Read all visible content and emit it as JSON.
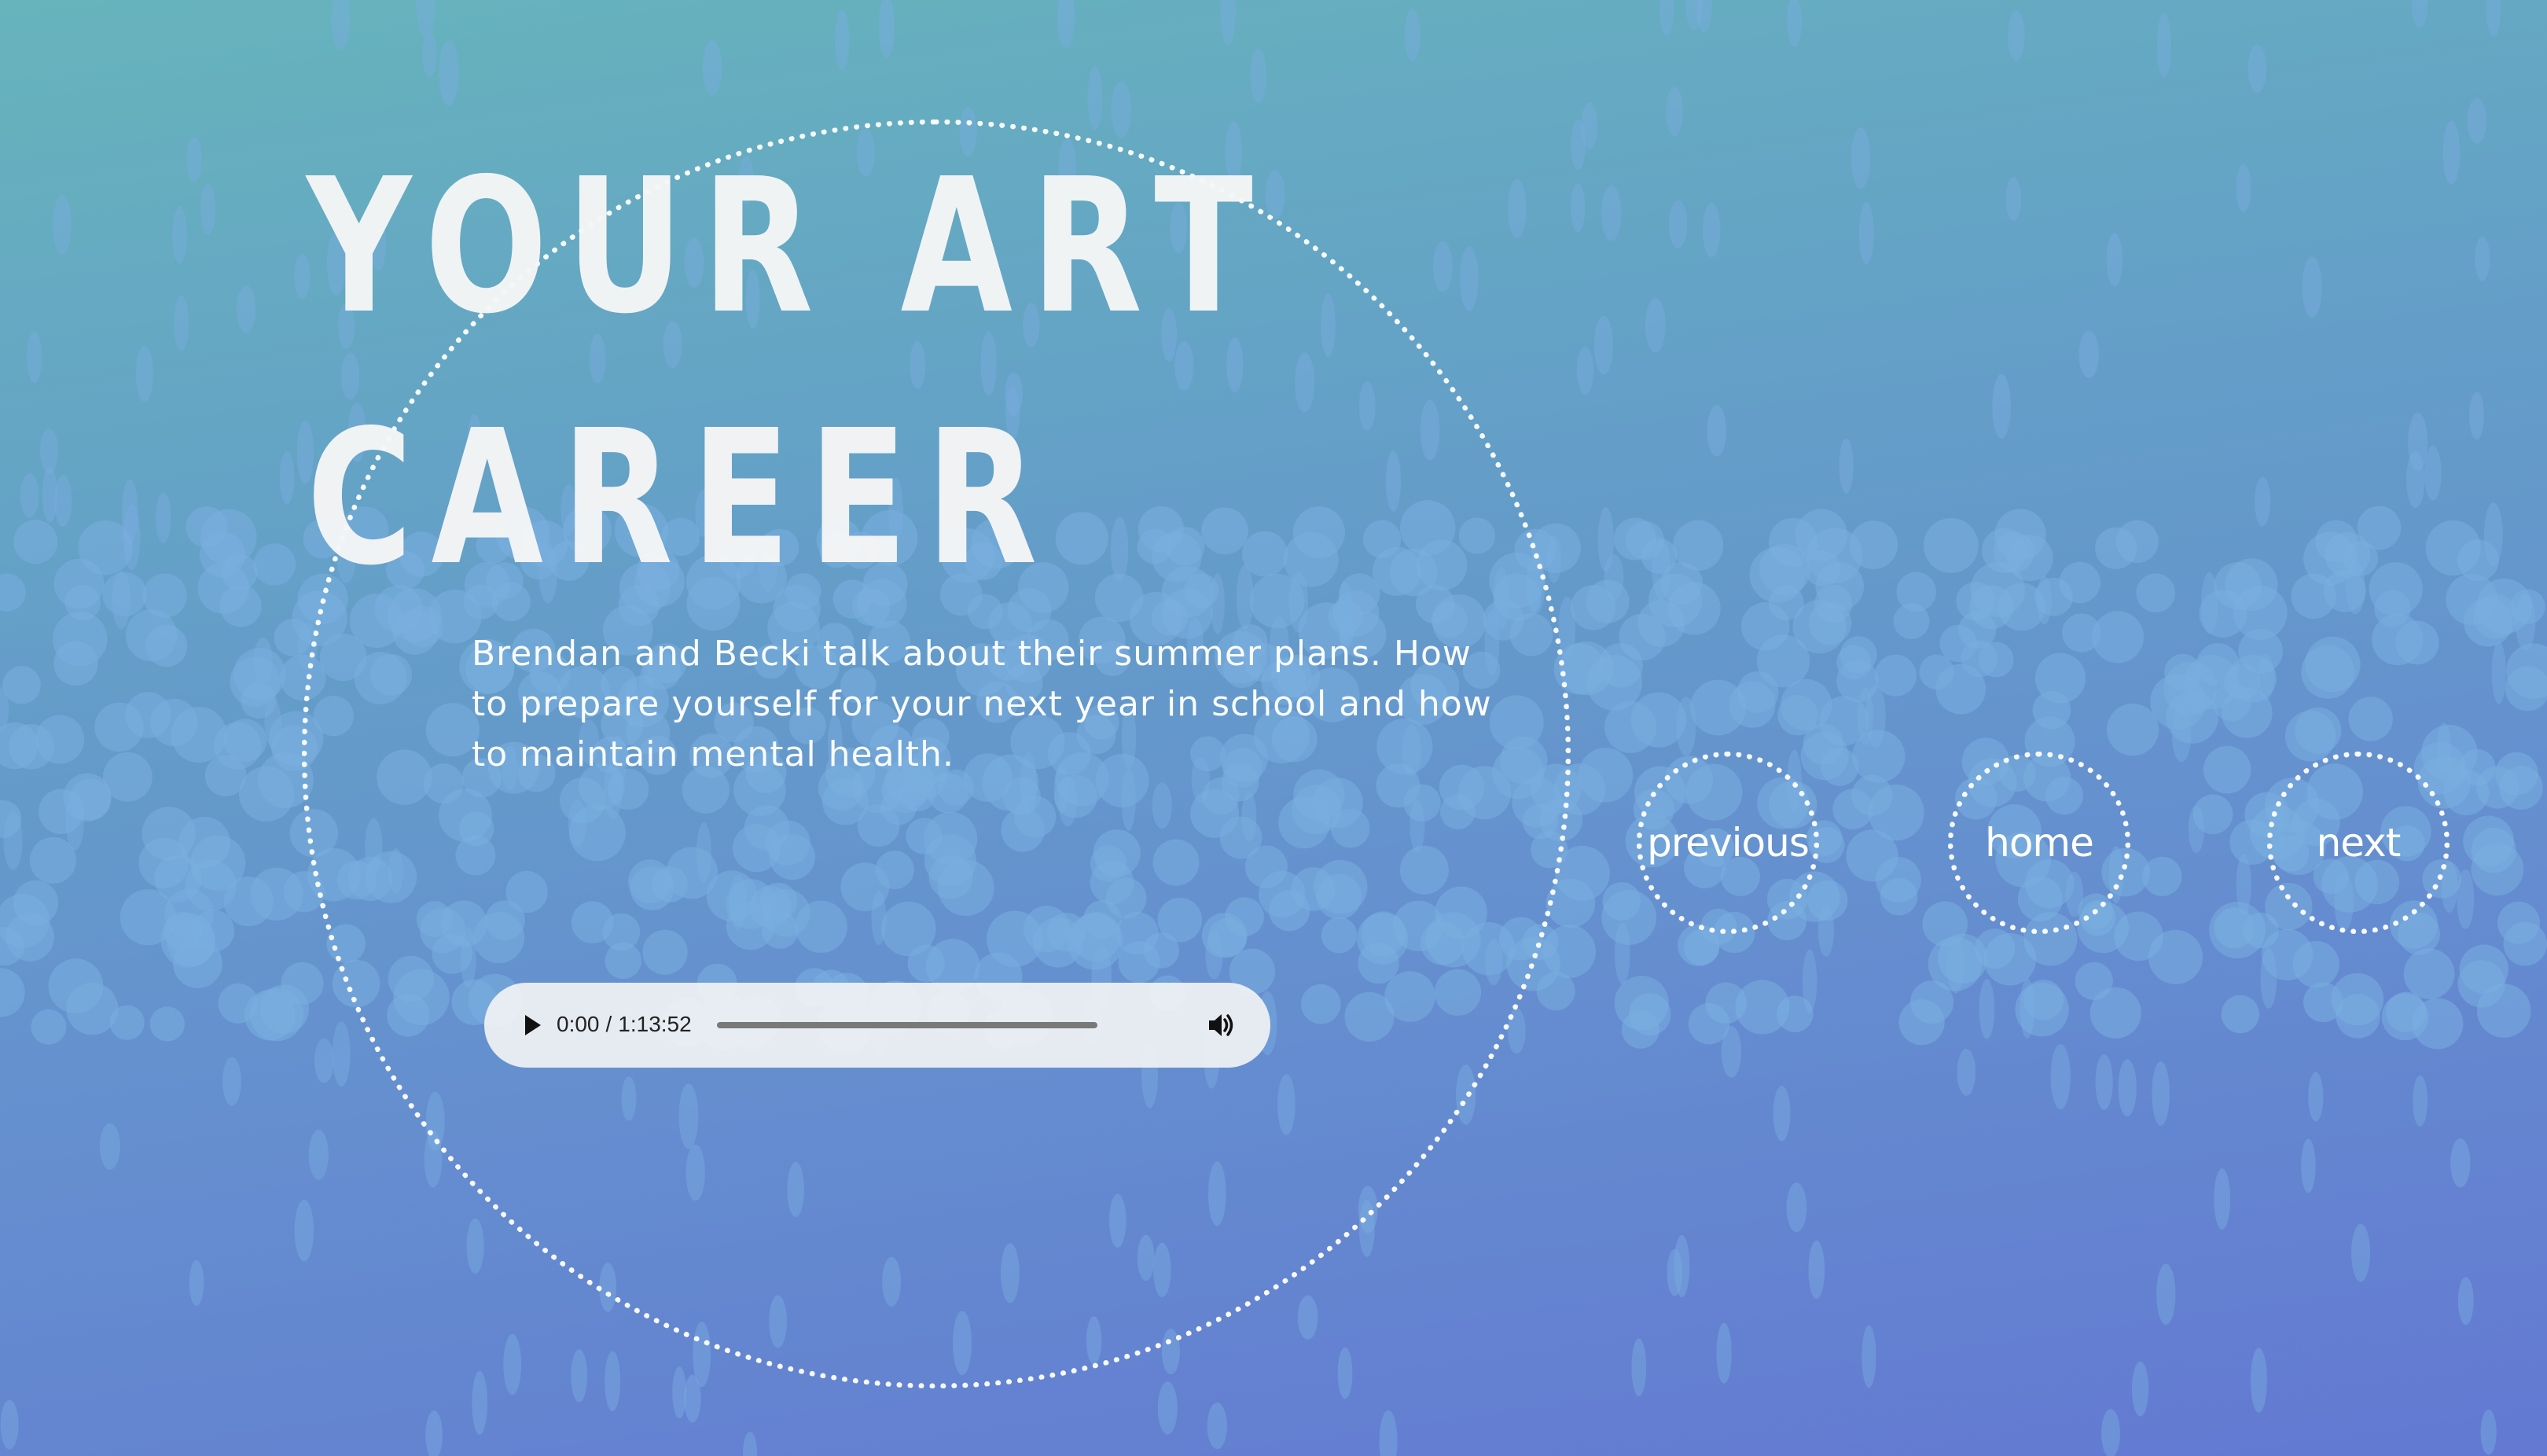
{
  "page": {
    "title_line1": "YOUR ART",
    "title_line2": "CAREER",
    "description": "Brendan and Becki talk about their summer plans. How to prepare yourself for your next year in school and how to maintain mental health."
  },
  "audio_player": {
    "current_time": "0:00",
    "separator": "/",
    "duration": "1:13:52",
    "progress": 0,
    "play_icon": "play-icon",
    "volume_icon": "volume-icon"
  },
  "navigation": {
    "previous_label": "previous",
    "home_label": "home",
    "next_label": "next"
  },
  "colors": {
    "gradient_top": "#67b4bc",
    "gradient_bottom": "#6379d2",
    "text": "#ffffff",
    "dots": "#7aaee0"
  }
}
